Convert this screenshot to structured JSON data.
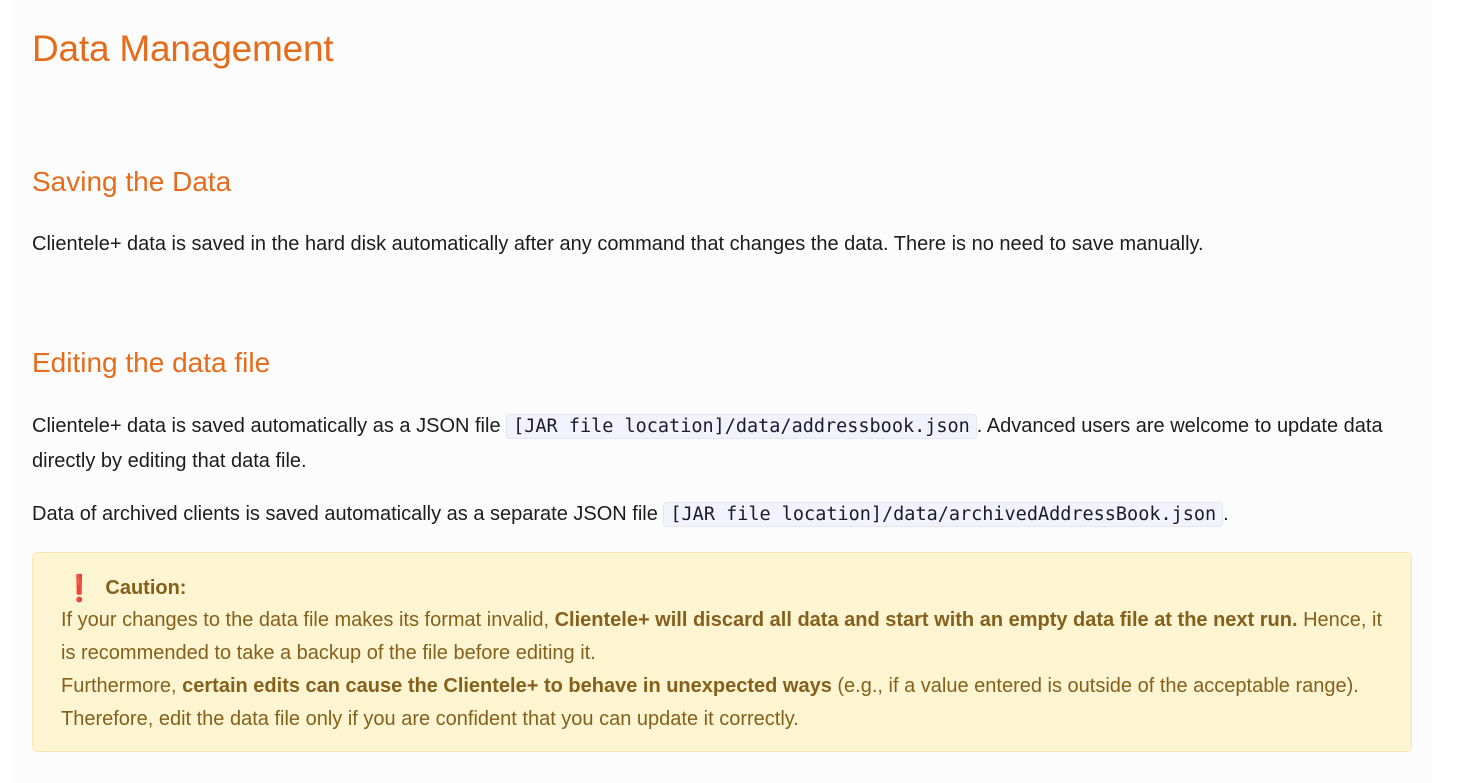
{
  "heading": "Data Management",
  "sections": {
    "saving": {
      "title": "Saving the Data",
      "text": "Clientele+ data is saved in the hard disk automatically after any command that changes the data. There is no need to save manually."
    },
    "editing": {
      "title": "Editing the data file",
      "p1_before": "Clientele+ data is saved automatically as a JSON file ",
      "p1_code": "[JAR file location]/data/addressbook.json",
      "p1_after": ". Advanced users are welcome to update data directly by editing that data file.",
      "p2_before": "Data of archived clients is saved automatically as a separate JSON file ",
      "p2_code": "[JAR file location]/data/archivedAddressBook.json",
      "p2_after": "."
    }
  },
  "caution": {
    "icon": "exclamation-icon",
    "title": "Caution:",
    "l1_before": "If your changes to the data file makes its format invalid, ",
    "l1_bold": "Clientele+ will discard all data and start with an empty data file at the next run.",
    "l1_after": " Hence, it is recommended to take a backup of the file before editing it.",
    "l2_before": "Furthermore, ",
    "l2_bold": "certain edits can cause the Clientele+ to behave in unexpected ways",
    "l2_after": " (e.g., if a value entered is outside of the acceptable range). Therefore, edit the data file only if you are confident that you can update it correctly."
  },
  "colors": {
    "heading": "#e46c1c",
    "caution_bg": "#fdf4d2",
    "caution_text": "#84601b",
    "icon": "#d0141f"
  }
}
